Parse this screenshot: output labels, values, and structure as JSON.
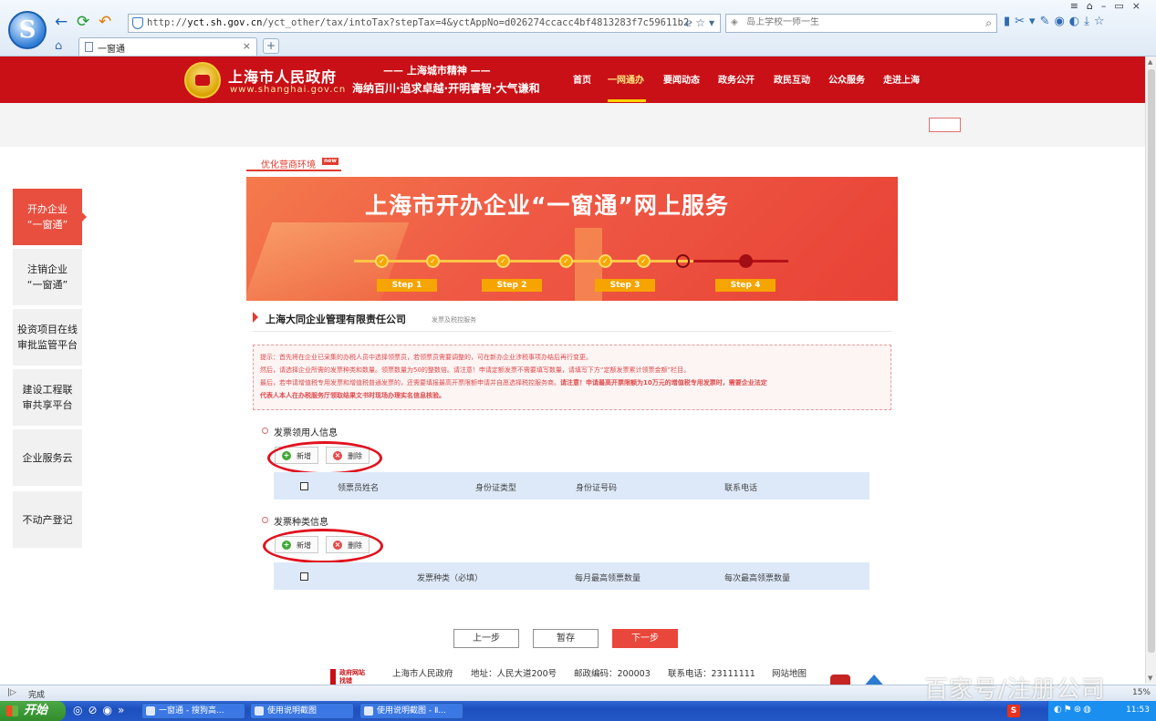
{
  "browser": {
    "url_prefix": "http://",
    "url_domain": "yct.sh.gov.cn",
    "url_path": "/yct_other/tax/intoTax?stepTax=4&yctAppNo=d026274ccacc4bf4813283f7c59611b2",
    "search_placeholder": "岛上学校一师一生",
    "tab_title": "一窗通",
    "status_text": "完成",
    "zoom_text": "15%"
  },
  "header": {
    "gov_name": "上海市人民政府",
    "gov_domain": "www.shanghai.gov.cn",
    "spirit_title": "—— 上海城市精神 ——",
    "spirit_slogan": "海纳百川·追求卓越·开明睿智·大气谦和",
    "nav": [
      {
        "label": "首页"
      },
      {
        "label": "一网通办"
      },
      {
        "label": "要闻动态"
      },
      {
        "label": "政务公开"
      },
      {
        "label": "政民互动"
      },
      {
        "label": "公众服务"
      },
      {
        "label": "走进上海"
      }
    ]
  },
  "sidebar": {
    "items": [
      {
        "line1": "开办企业",
        "line2": "“一窗通”"
      },
      {
        "line1": "注销企业",
        "line2": "“一窗通”"
      },
      {
        "line1": "投资项目在线",
        "line2": "审批监管平台"
      },
      {
        "line1": "建设工程联",
        "line2": "审共享平台"
      },
      {
        "line1": "企业服务云",
        "line2": ""
      },
      {
        "line1": "不动产登记",
        "line2": ""
      }
    ]
  },
  "main": {
    "opt_tab_label": "优化营商环境",
    "new_badge": "new",
    "banner_title": "上海市开办企业“一窗通”网上服务",
    "steps": [
      "Step 1",
      "Step 2",
      "Step 3",
      "Step 4"
    ],
    "company_name": "上海大同企业管理有限责任公司",
    "company_sub": "发票及税控服务",
    "notice": {
      "line1": "提示：首先将在企业已采集的办税人员中选择领票员，若领票员需要调整的，可在新办企业涉税事项办结后再行变更。",
      "line2": "然后，请选择企业所需的发票种类和数量。领票数量为50的整数倍。请注意！申请定额发票不需要填写数量，请填写下方“定额发票累计领票金额”栏目。",
      "line3_normal": "最后，若申请增值税专用发票和增值税普通发票的，还需要填报最高开票限额申请并自愿选择税控服务商。",
      "line3_bold": "请注意！申请最高开票限额为10万元的增值税专用发票时，需要企业法定",
      "line4_bold": "代表人本人在办税服务厅领取结果文书时现场办理实名信息核验。"
    },
    "section1": {
      "title": "发票领用人信息",
      "add_label": "新增",
      "delete_label": "删除",
      "columns": [
        "领票员姓名",
        "身份证类型",
        "身份证号码",
        "联系电话"
      ]
    },
    "section2": {
      "title": "发票种类信息",
      "add_label": "新增",
      "delete_label": "删除",
      "columns": [
        "发票种类（必填）",
        "每月最高领票数量",
        "每次最高领票数量"
      ]
    },
    "buttons": {
      "prev": "上一步",
      "save": "暂存",
      "next": "下一步"
    }
  },
  "footer": {
    "logo_line1": "政府网站",
    "logo_line2": "找错",
    "org": "上海市人民政府",
    "address": "地址：人民大道200号",
    "postcode": "邮政编码：200003",
    "phone": "联系电话：23111111",
    "sitemap": "网站地图"
  },
  "watermark": "百家号/注册公司",
  "taskbar": {
    "start_label": "开始",
    "tasks": [
      {
        "label": "一窗通 - 搜狗高..."
      },
      {
        "label": "使用说明截图"
      },
      {
        "label": "使用说明截图 - Ⅱ..."
      }
    ],
    "clock": "11:53",
    "ime": "S"
  }
}
